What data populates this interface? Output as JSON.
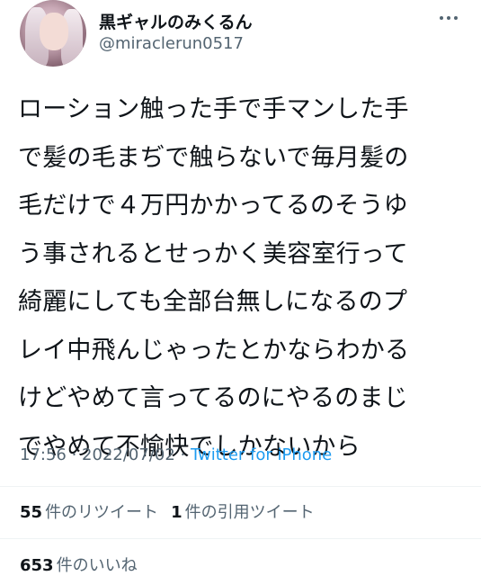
{
  "tweet": {
    "display_name": "黒ギャルのみくるん",
    "handle": "@miraclerun0517",
    "avatar_icon": "user-avatar",
    "more_icon": "more-horizontal-icon",
    "body_lines": [
      "ローション触った手で手マンした手",
      "で髪の毛まぢで触らないで毎月髪の",
      "毛だけで４万円かかってるのそうゆ",
      "う事されるとせっかく美容室行って",
      "綺麗にしても全部台無しになるのプ",
      "レイ中飛んじゃったとかならわかる",
      "けどやめて言ってるのにやるのまじ",
      "でやめて不愉快でしかないから"
    ],
    "time": "17:56",
    "separator": " · ",
    "date": "2022/07/02",
    "source": "Twitter for iPhone"
  },
  "stats": {
    "retweet_count": "55",
    "retweet_label": "件のリツイート",
    "quote_count": "1",
    "quote_label": "件の引用ツイート",
    "like_count": "653",
    "like_label": "件のいいね"
  },
  "colors": {
    "text": "#0f1419",
    "secondary": "#536471",
    "link": "#1d9bf0",
    "divider": "#eff3f4"
  }
}
